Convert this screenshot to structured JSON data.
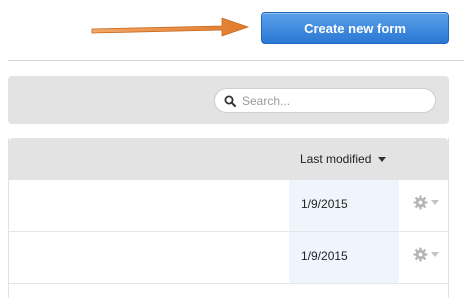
{
  "header": {
    "create_button_label": "Create new form"
  },
  "toolbar": {
    "search_placeholder": "Search..."
  },
  "table": {
    "sort_column_label": "Last modified",
    "rows": [
      {
        "last_modified": "1/9/2015"
      },
      {
        "last_modified": "1/9/2015"
      }
    ]
  },
  "colors": {
    "accent_arrow": "#e07a2a",
    "primary_button": "#2f7fd8",
    "highlight_column": "#eef5fd"
  },
  "icons": [
    "arrow-icon",
    "search-icon",
    "sort-caret-icon",
    "gear-icon",
    "chevron-down-icon"
  ]
}
